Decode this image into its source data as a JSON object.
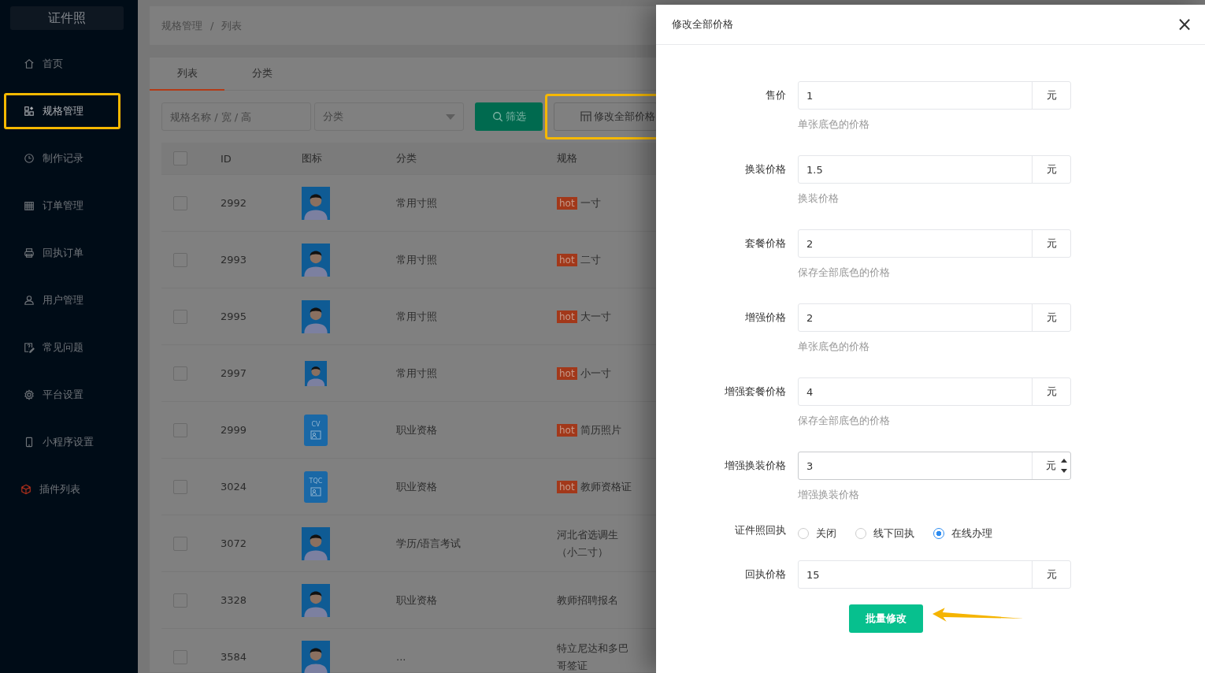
{
  "sidebar": {
    "logo": "证件照",
    "items": [
      {
        "label": "首页",
        "highlighted": false
      },
      {
        "label": "规格管理",
        "highlighted": true
      },
      {
        "label": "制作记录",
        "highlighted": false
      },
      {
        "label": "订单管理",
        "highlighted": false
      },
      {
        "label": "回执订单",
        "highlighted": false
      },
      {
        "label": "用户管理",
        "highlighted": false
      },
      {
        "label": "常见问题",
        "highlighted": false
      },
      {
        "label": "平台设置",
        "highlighted": false
      },
      {
        "label": "小程序设置",
        "highlighted": false
      },
      {
        "label": "插件列表",
        "highlighted": false
      }
    ]
  },
  "breadcrumb": {
    "items": [
      "规格管理",
      "列表"
    ],
    "separator": "/"
  },
  "tabs": [
    {
      "label": "列表",
      "selected": true
    },
    {
      "label": "分类",
      "selected": false
    }
  ],
  "toolbar": {
    "search": {
      "placeholder": "规格名称 / 宽 / 高"
    },
    "category_select": {
      "placeholder": "分类"
    },
    "filter_button": "筛选",
    "edit_all_button": {
      "label": "修改全部价格",
      "highlighted": true
    }
  },
  "table": {
    "header_checked": false,
    "columns": [
      "ID",
      "图标",
      "分类",
      "规格"
    ],
    "rows": [
      {
        "checked": false,
        "id": "2992",
        "icon": {
          "kind": "avatar"
        },
        "category": "常用寸照",
        "tag": "hot",
        "spec": "一寸"
      },
      {
        "checked": false,
        "id": "2993",
        "icon": {
          "kind": "avatar"
        },
        "category": "常用寸照",
        "tag": "hot",
        "spec": "二寸"
      },
      {
        "checked": false,
        "id": "2995",
        "icon": {
          "kind": "avatar"
        },
        "category": "常用寸照",
        "tag": "hot",
        "spec": "大一寸"
      },
      {
        "checked": false,
        "id": "2997",
        "icon": {
          "kind": "avatar_small"
        },
        "category": "常用寸照",
        "tag": "hot",
        "spec": "小一寸"
      },
      {
        "checked": false,
        "id": "2999",
        "icon": {
          "kind": "badge",
          "text": "CV"
        },
        "category": "职业资格",
        "tag": "hot",
        "spec": "简历照片"
      },
      {
        "checked": false,
        "id": "3024",
        "icon": {
          "kind": "badge",
          "text": "TQC"
        },
        "category": "职业资格",
        "tag": "hot",
        "spec": "教师资格证"
      },
      {
        "checked": false,
        "id": "3072",
        "icon": {
          "kind": "avatar"
        },
        "category": "学历/语言考试",
        "spec": "河北省选调生（小二寸）"
      },
      {
        "checked": false,
        "id": "3328",
        "icon": {
          "kind": "avatar"
        },
        "category": "职业资格",
        "spec": "教师招聘报名"
      },
      {
        "checked": false,
        "id": "3584",
        "icon": {
          "kind": "avatar"
        },
        "category": "...",
        "spec": "特立尼达和多巴哥签证"
      }
    ]
  },
  "drawer": {
    "title": "修改全部价格",
    "close": "×",
    "fields": [
      {
        "kind": "number",
        "label": "售价",
        "value": "1",
        "unit": "元",
        "hint": "单张底色的价格",
        "focused": false
      },
      {
        "kind": "number",
        "label": "换装价格",
        "value": "1.5",
        "unit": "元",
        "hint": "换装价格",
        "focused": false
      },
      {
        "kind": "number",
        "label": "套餐价格",
        "value": "2",
        "unit": "元",
        "hint": "保存全部底色的价格",
        "focused": false
      },
      {
        "kind": "number",
        "label": "增强价格",
        "value": "2",
        "unit": "元",
        "hint": "单张底色的价格",
        "focused": false
      },
      {
        "kind": "number",
        "label": "增强套餐价格",
        "value": "4",
        "unit": "元",
        "hint": "保存全部底色的价格",
        "focused": false
      },
      {
        "kind": "number",
        "label": "增强换装价格",
        "value": "3",
        "unit": "元",
        "hint": "增强换装价格",
        "focused": true
      },
      {
        "kind": "radio",
        "label": "证件照回执",
        "options": [
          {
            "label": "关闭",
            "selected": false
          },
          {
            "label": "线下回执",
            "selected": false
          },
          {
            "label": "在线办理",
            "selected": true
          }
        ]
      },
      {
        "kind": "number",
        "label": "回执价格",
        "value": "15",
        "unit": "元",
        "focused": false
      }
    ],
    "submit": {
      "label": "批量修改",
      "highlighted": true
    }
  }
}
